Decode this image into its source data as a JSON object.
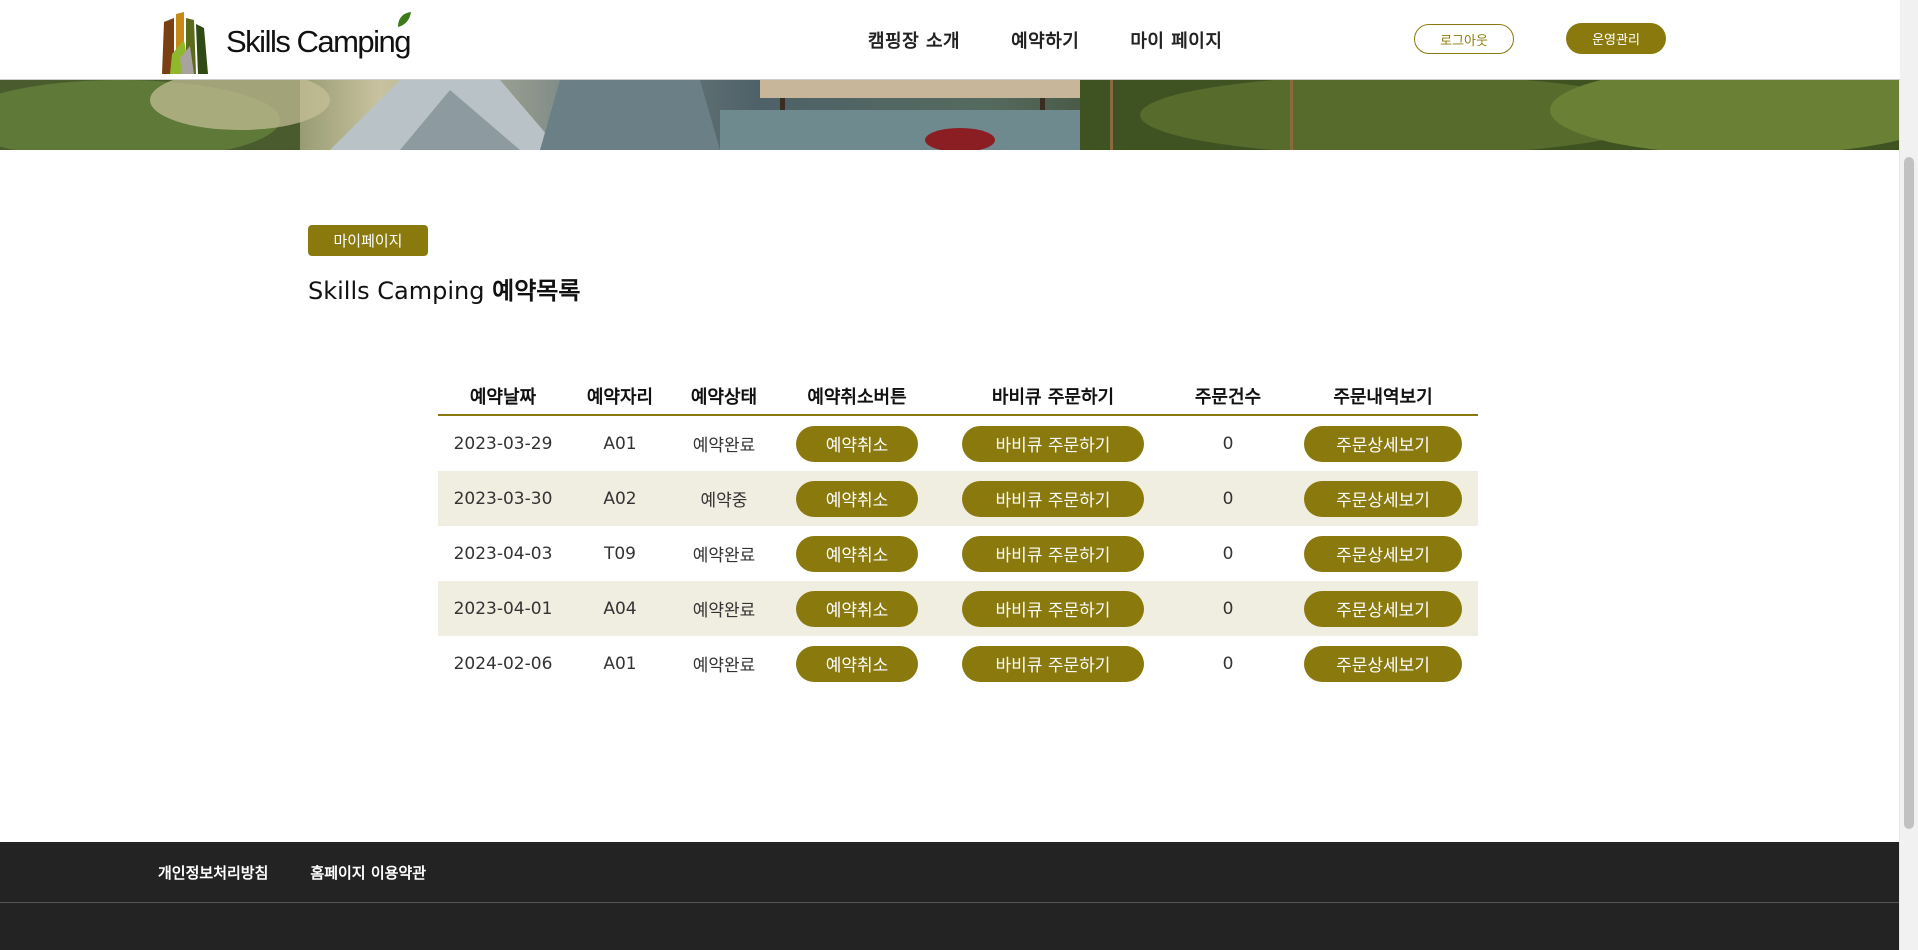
{
  "header": {
    "logo_text": "Skills Camping",
    "nav": [
      "캠핑장 소개",
      "예약하기",
      "마이 페이지"
    ],
    "logout_label": "로그아웃",
    "admin_label": "운영관리"
  },
  "main": {
    "badge": "마이페이지",
    "title_prefix": "Skills Camping",
    "title_bold": "예약목록"
  },
  "table": {
    "headers": [
      "예약날짜",
      "예약자리",
      "예약상태",
      "예약취소버튼",
      "바비큐 주문하기",
      "주문건수",
      "주문내역보기"
    ],
    "rows": [
      {
        "date": "2023-03-29",
        "seat": "A01",
        "status": "예약완료",
        "cancel": "예약취소",
        "bbq": "바비큐 주문하기",
        "count": "0",
        "detail": "주문상세보기"
      },
      {
        "date": "2023-03-30",
        "seat": "A02",
        "status": "예약중",
        "cancel": "예약취소",
        "bbq": "바비큐 주문하기",
        "count": "0",
        "detail": "주문상세보기"
      },
      {
        "date": "2023-04-03",
        "seat": "T09",
        "status": "예약완료",
        "cancel": "예약취소",
        "bbq": "바비큐 주문하기",
        "count": "0",
        "detail": "주문상세보기"
      },
      {
        "date": "2023-04-01",
        "seat": "A04",
        "status": "예약완료",
        "cancel": "예약취소",
        "bbq": "바비큐 주문하기",
        "count": "0",
        "detail": "주문상세보기"
      },
      {
        "date": "2024-02-06",
        "seat": "A01",
        "status": "예약완료",
        "cancel": "예약취소",
        "bbq": "바비큐 주문하기",
        "count": "0",
        "detail": "주문상세보기"
      }
    ]
  },
  "footer": {
    "links": [
      "개인정보처리방침",
      "홈페이지 이용약관"
    ]
  },
  "colors": {
    "accent": "#8a7a0e",
    "row_alt": "#f0eee1",
    "footer_bg": "#232323"
  }
}
